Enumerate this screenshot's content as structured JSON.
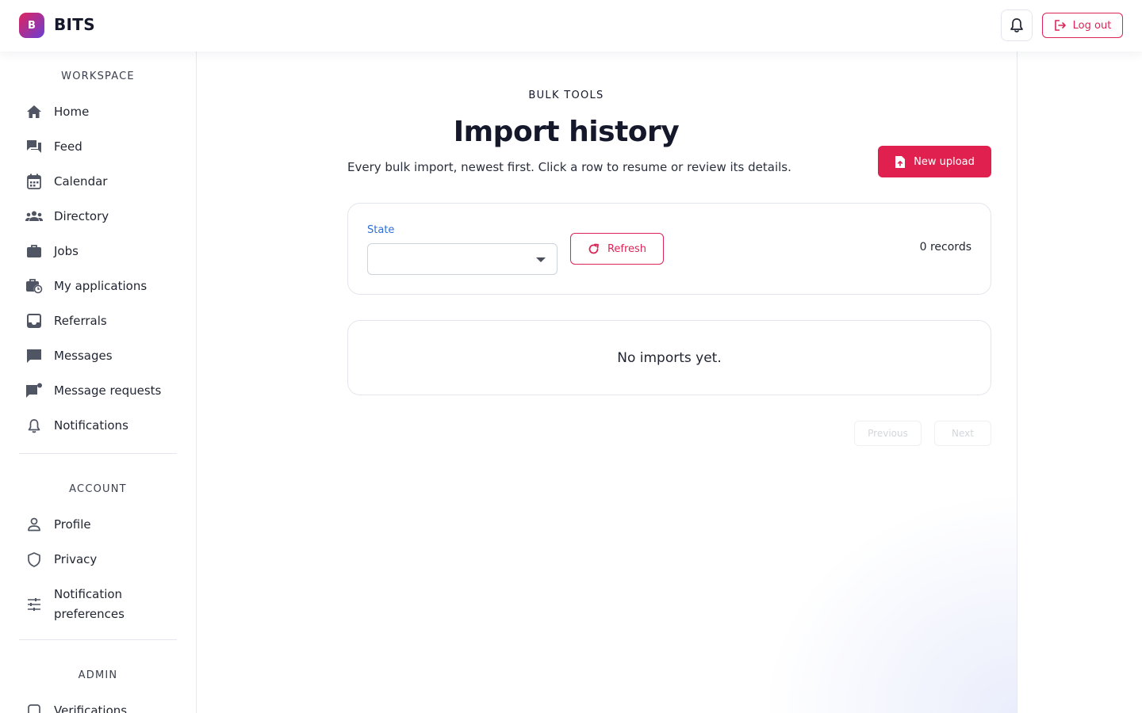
{
  "brand": {
    "logo_letter": "B",
    "name": "BITS"
  },
  "header": {
    "logout_label": "Log out",
    "accent": "#dc2456"
  },
  "sidebar": {
    "workspace_title": "WORKSPACE",
    "workspace_items": [
      {
        "label": "Home",
        "icon": "home-icon"
      },
      {
        "label": "Feed",
        "icon": "feed-icon"
      },
      {
        "label": "Calendar",
        "icon": "calendar-icon"
      },
      {
        "label": "Directory",
        "icon": "people-icon"
      },
      {
        "label": "Jobs",
        "icon": "briefcase-icon"
      },
      {
        "label": "My applications",
        "icon": "briefcase-clock-icon"
      },
      {
        "label": "Referrals",
        "icon": "inbox-icon"
      },
      {
        "label": "Messages",
        "icon": "message-icon"
      },
      {
        "label": "Message requests",
        "icon": "message-request-icon"
      },
      {
        "label": "Notifications",
        "icon": "bell-icon"
      }
    ],
    "account_title": "ACCOUNT",
    "account_items": [
      {
        "label": "Profile",
        "icon": "person-icon"
      },
      {
        "label": "Privacy",
        "icon": "shield-icon"
      },
      {
        "label": "Notification preferences",
        "icon": "sliders-icon"
      }
    ],
    "admin_title": "ADMIN",
    "admin_items": [
      {
        "label": "Verifications",
        "icon": "verify-icon"
      }
    ]
  },
  "main": {
    "eyebrow": "BULK TOOLS",
    "title": "Import history",
    "subtitle": "Every bulk import, newest first. Click a row to resume or review its details.",
    "new_upload_label": "New upload",
    "filter": {
      "state_label": "State",
      "state_value": "",
      "refresh_label": "Refresh",
      "records_text": "0 records"
    },
    "empty_text": "No imports yet.",
    "pagination": {
      "previous_label": "Previous",
      "next_label": "Next"
    }
  }
}
